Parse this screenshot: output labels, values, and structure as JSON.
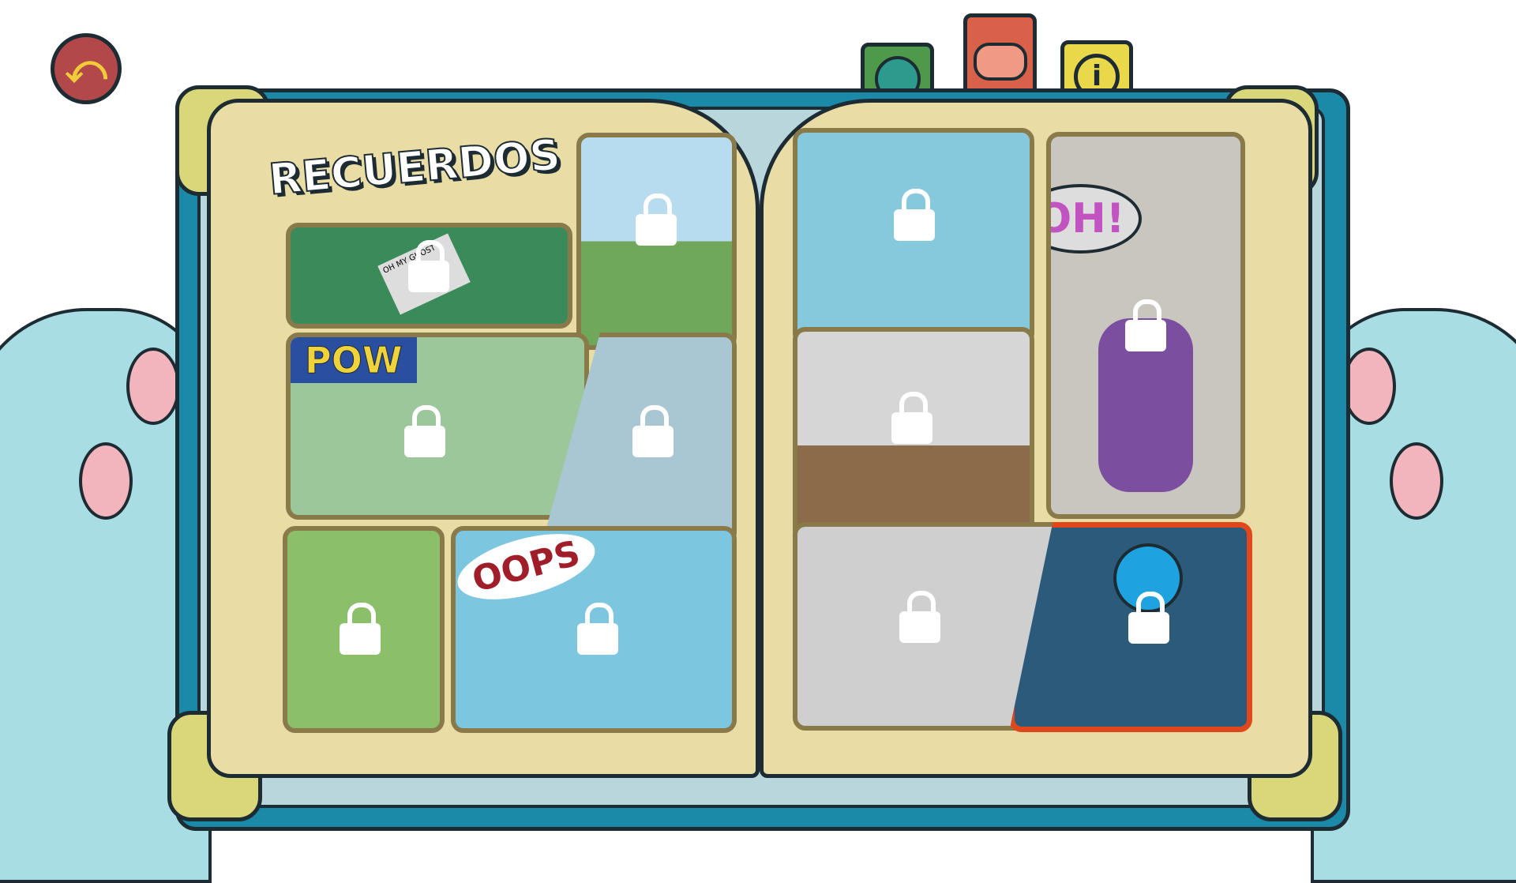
{
  "title": "RECUERDOS",
  "back_button": {
    "icon": "back-arrow-icon",
    "color": "#b3484a"
  },
  "tabs": [
    {
      "name": "world",
      "icon": "globe-icon",
      "color": "#4f9a4a"
    },
    {
      "name": "thoughts",
      "icon": "thought-cloud-icon",
      "color": "#d9614a"
    },
    {
      "name": "info",
      "icon": "info-icon",
      "color": "#e9d84a"
    }
  ],
  "panels": [
    {
      "id": "newspaper",
      "text": "OH MY GHOST",
      "locked": true
    },
    {
      "id": "city",
      "locked": true
    },
    {
      "id": "pow",
      "text": "POW",
      "locked": true
    },
    {
      "id": "burst",
      "locked": true
    },
    {
      "id": "pond",
      "locked": true
    },
    {
      "id": "oops",
      "text": "OOPS",
      "locked": true
    },
    {
      "id": "cat-sky",
      "locked": true
    },
    {
      "id": "door",
      "text": "OH!",
      "locked": true
    },
    {
      "id": "room",
      "locked": true
    },
    {
      "id": "sofa",
      "locked": true
    },
    {
      "id": "portal",
      "locked": true,
      "selected": true
    }
  ],
  "colors": {
    "selected_border": "#e0471c",
    "page": "#e9dca5",
    "cover": "#1a8aa8"
  }
}
